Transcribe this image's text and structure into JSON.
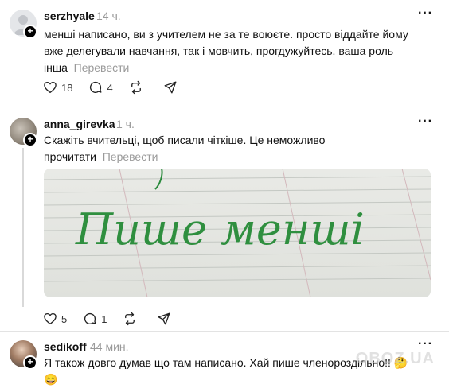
{
  "posts": [
    {
      "username": "serzhyale",
      "time": "14 ч.",
      "text": "менші написано, ви з учителем не за те воюєте. просто віддайте йому вже делегували навчання, так і мовчить, прогдужуйтесь. ваша роль інша",
      "line1": "менші написано, ви з учителем не за те воюєте. просто віддайте йому",
      "line2": "вже делегували навчання, так і мовчить, прогдужуйтесь. ваша роль",
      "line3": "інша",
      "translate": "Перевести",
      "likes": "18",
      "replies": "4"
    },
    {
      "username": "anna_girevka",
      "time": "1 ч.",
      "line1": "Скажіть вчительці, щоб писали чіткіше. Це неможливо",
      "line2": "прочитати",
      "translate": "Перевести",
      "image_text": "Пише менші",
      "likes": "5",
      "replies": "1"
    },
    {
      "username": "sedikoff",
      "time": "44 мин.",
      "line1": "Я також довго думав що там написано. Хай пише членороздільно!!",
      "emoji1": "🤔",
      "emoji2": "😄"
    }
  ],
  "icons": [
    "heart-icon",
    "comment-icon",
    "repost-icon",
    "share-icon",
    "more-icon",
    "plus-icon"
  ],
  "watermark": "OBOZ.UA"
}
